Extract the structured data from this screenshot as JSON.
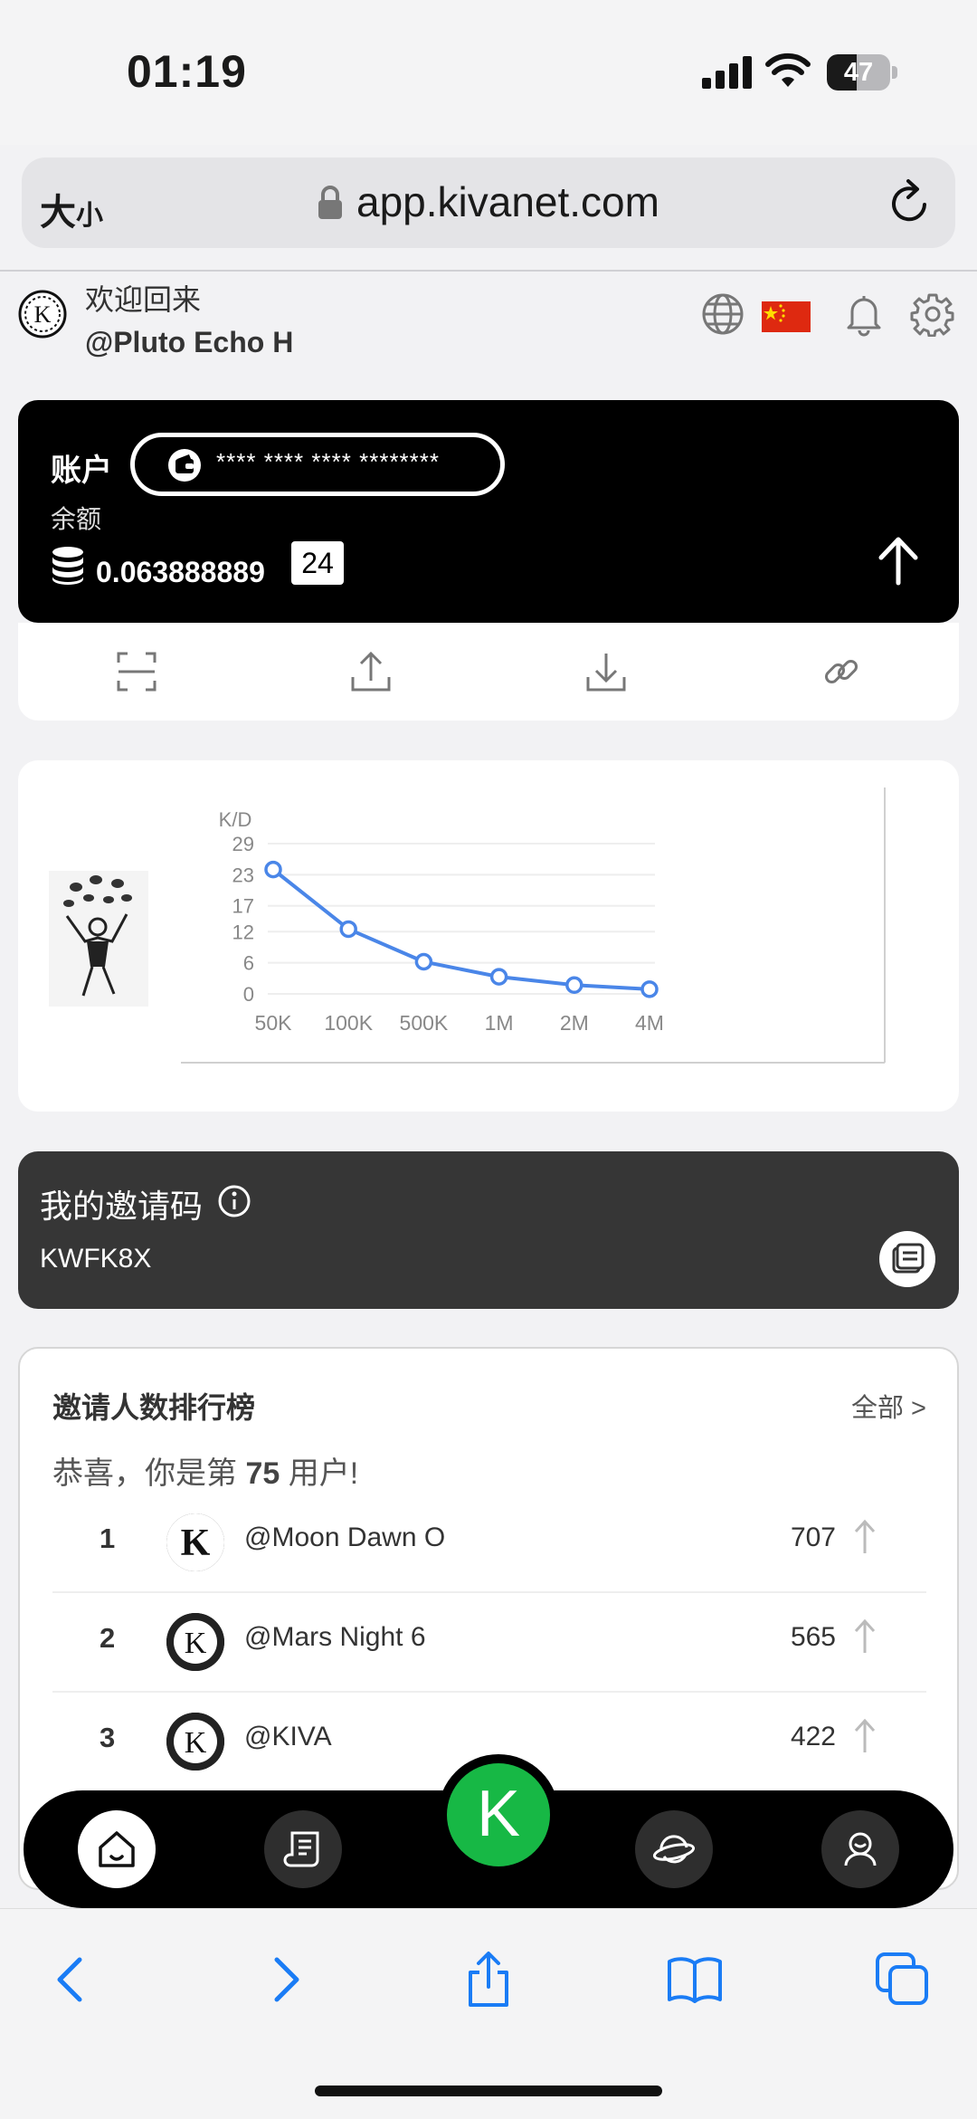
{
  "status": {
    "time": "01:19",
    "battery": "47",
    "battery_level": 0.47
  },
  "browser": {
    "size_label_big": "大",
    "size_label_small": "小",
    "url": "app.kivanet.com"
  },
  "header": {
    "welcome": "欢迎回来",
    "username": "@Pluto Echo H"
  },
  "account": {
    "title": "账户",
    "masked_address": "**** **** **** ********",
    "balance_label": "余额",
    "balance": "0.063888889",
    "badge": "24"
  },
  "chart_data": {
    "type": "line",
    "ylabel": "K/D",
    "categories": [
      "50K",
      "100K",
      "500K",
      "1M",
      "2M",
      "4M"
    ],
    "values": [
      24,
      12.5,
      6.2,
      3.3,
      1.7,
      0.9
    ],
    "yticks": [
      "29",
      "23",
      "17",
      "12",
      "6",
      "0"
    ],
    "ylim": [
      0,
      29
    ],
    "grid": true,
    "color": "#4a86e8"
  },
  "invite": {
    "title": "我的邀请码",
    "code": "KWFK8X"
  },
  "leaderboard": {
    "title": "邀请人数排行榜",
    "all": "全部 >",
    "congrats_prefix": "恭喜，你是第 ",
    "rank": "75",
    "congrats_suffix": " 用户!",
    "rows": [
      {
        "rank": "1",
        "name": "@Moon Dawn O",
        "score": "707"
      },
      {
        "rank": "2",
        "name": "@Mars Night 6",
        "score": "565"
      },
      {
        "rank": "3",
        "name": "@KIVA",
        "score": "422"
      }
    ]
  },
  "nav": {
    "center_label": "K"
  },
  "colors": {
    "accent_green": "#17b845",
    "chart_blue": "#4a86e8",
    "safari_blue": "#1a7cf5"
  }
}
